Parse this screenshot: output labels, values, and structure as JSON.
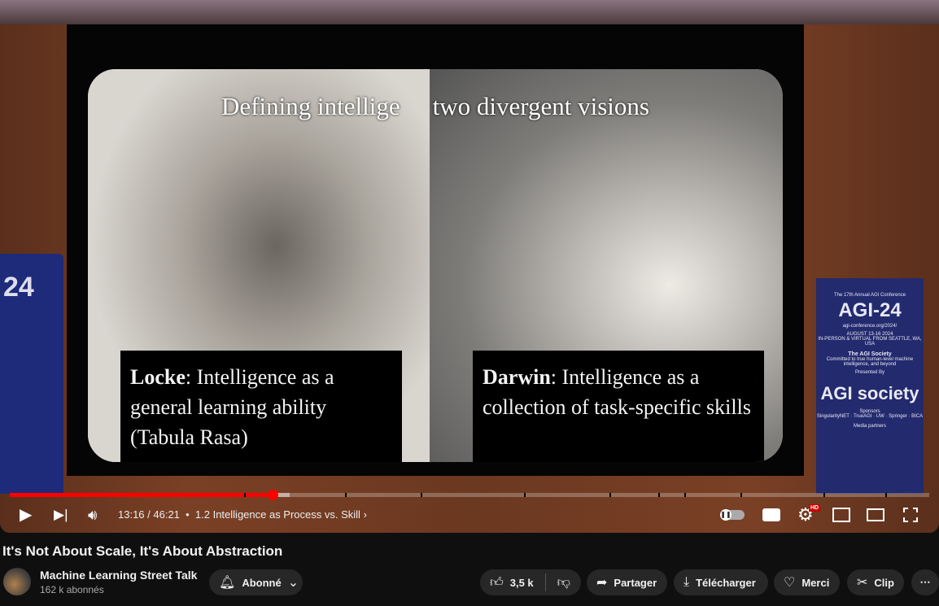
{
  "video": {
    "slide_title_visible_left": "Defining intellige",
    "slide_title_visible_right": "two divergent visions",
    "locke_name": "Locke",
    "locke_text": ":  Intelligence as a general learning ability (Tabula Rasa)",
    "darwin_name": "Darwin",
    "darwin_text": ": Intelligence as a collection of task-specific skills",
    "banner_right": {
      "line1": "The 17th Annual AGI Conference",
      "big": "AGI-24",
      "url": "agi-conference.org/2024/",
      "dates": "AUGUST 13-16 2024",
      "location": "IN-PERSON & VIRTUAL FROM SEATTLE, WA, USA",
      "society": "The AGI Society",
      "tagline": "Committed to true human-level machine intelligence, and beyond",
      "presented": "Presented By",
      "logo": "AGI society",
      "sponsors": "Sponsors",
      "sponsor_list": "SingularityNET · TrueAGI · UW · Springer · BICA",
      "media": "Media partners"
    },
    "banner_left": "24"
  },
  "player": {
    "progress_fraction": 0.286,
    "buffered_fraction": 0.304,
    "accent": "#ff0000",
    "time": "13:16 / 46:21",
    "chapter": "1.2 Intelligence as Process vs. Skill",
    "hd_badge": "HD",
    "icons": [
      "play-icon",
      "next-icon",
      "volume-icon",
      "autoplay-toggle",
      "subtitles-icon",
      "settings-icon",
      "miniplayer-icon",
      "theater-icon",
      "fullscreen-icon"
    ]
  },
  "meta": {
    "title": "It's Not About Scale, It's About Abstraction",
    "channel": "Machine Learning Street Talk",
    "subscribers": "162 k abonnés",
    "subscribe_label": "Abonné",
    "likes": "3,5 k",
    "share": "Partager",
    "download": "Télécharger",
    "thanks": "Merci",
    "clip": "Clip",
    "more": "⋯"
  }
}
